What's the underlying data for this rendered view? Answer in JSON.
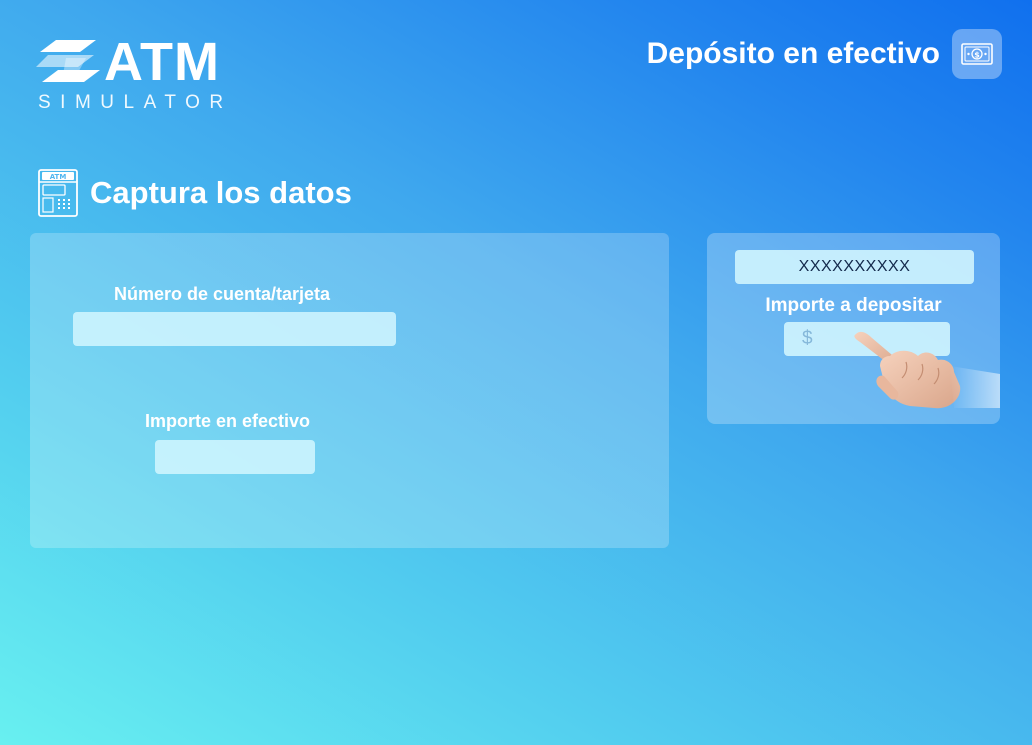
{
  "brand": {
    "title": "ATM",
    "subtitle": "SIMULATOR"
  },
  "header": {
    "title": "Depósito en efectivo",
    "icon": "cash-bill-icon"
  },
  "section": {
    "title": "Captura los datos",
    "icon": "atm-machine-icon",
    "icon_text": "ATM"
  },
  "form": {
    "account_label": "Número de cuenta/tarjeta",
    "account_value": "",
    "cash_label": "Importe en efectivo",
    "cash_value": ""
  },
  "preview": {
    "account_value": "XXXXXXXXXX",
    "amount_label": "Importe a depositar",
    "amount_placeholder": "$",
    "pointer": "pointing-hand-icon"
  },
  "colors": {
    "gradient_start": "#68f0f0",
    "gradient_end": "#1070ee",
    "text": "#ffffff",
    "input_fill": "#d6f8ff",
    "preview_text": "#13294b"
  }
}
